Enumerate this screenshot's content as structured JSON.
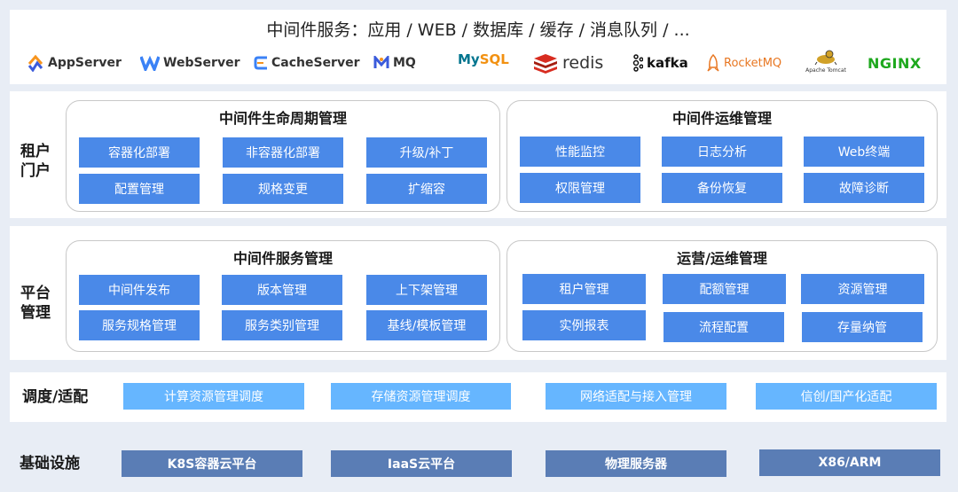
{
  "header": {
    "title": "中间件服务：应用 / WEB / 数据库 / 缓存 / 消息队列 / ...",
    "logos": [
      {
        "name": "AppServer",
        "icon": "appserver-icon"
      },
      {
        "name": "WebServer",
        "icon": "webserver-icon"
      },
      {
        "name": "CacheServer",
        "icon": "cacheserver-icon"
      },
      {
        "name": "MQ",
        "icon": "mq-icon"
      },
      {
        "name": "MySQL",
        "icon": "mysql-dolphin-icon"
      },
      {
        "name": "redis",
        "icon": "redis-icon"
      },
      {
        "name": "kafka",
        "icon": "kafka-icon"
      },
      {
        "name": "RocketMQ",
        "icon": "rocket-icon"
      },
      {
        "name": "Apache Tomcat",
        "icon": "tomcat-cat-icon"
      },
      {
        "name": "NGINX",
        "icon": "nginx-icon"
      }
    ]
  },
  "tenant_portal": {
    "label_line1": "租户",
    "label_line2": "门户",
    "groups": [
      {
        "title": "中间件生命周期管理",
        "items": [
          "容器化部署",
          "非容器化部署",
          "升级/补丁",
          "配置管理",
          "规格变更",
          "扩缩容"
        ]
      },
      {
        "title": "中间件运维管理",
        "items": [
          "性能监控",
          "日志分析",
          "Web终端",
          "权限管理",
          "备份恢复",
          "故障诊断"
        ]
      }
    ]
  },
  "platform_mgmt": {
    "label_line1": "平台",
    "label_line2": "管理",
    "groups": [
      {
        "title": "中间件服务管理",
        "items": [
          "中间件发布",
          "版本管理",
          "上下架管理",
          "服务规格管理",
          "服务类别管理",
          "基线/模板管理"
        ]
      },
      {
        "title": "运营/运维管理",
        "items": [
          "租户管理",
          "配额管理",
          "资源管理",
          "实例报表",
          "流程配置",
          "存量纳管"
        ]
      }
    ]
  },
  "scheduling": {
    "label": "调度/适配",
    "items": [
      "计算资源管理调度",
      "存储资源管理调度",
      "网络适配与接入管理",
      "信创/国产化适配"
    ]
  },
  "infrastructure": {
    "label": "基础设施",
    "items": [
      "K8S容器云平台",
      "IaaS云平台",
      "物理服务器",
      "X86/ARM"
    ]
  },
  "colors": {
    "primary_button": "#4a89e8",
    "light_button": "#66b6ff",
    "dark_button": "#5a7db5",
    "background": "#e8edf5",
    "redis": "#d82c20",
    "nginx": "#1ea81e",
    "rocketmq": "#e87722",
    "mysql": "#00758f"
  }
}
